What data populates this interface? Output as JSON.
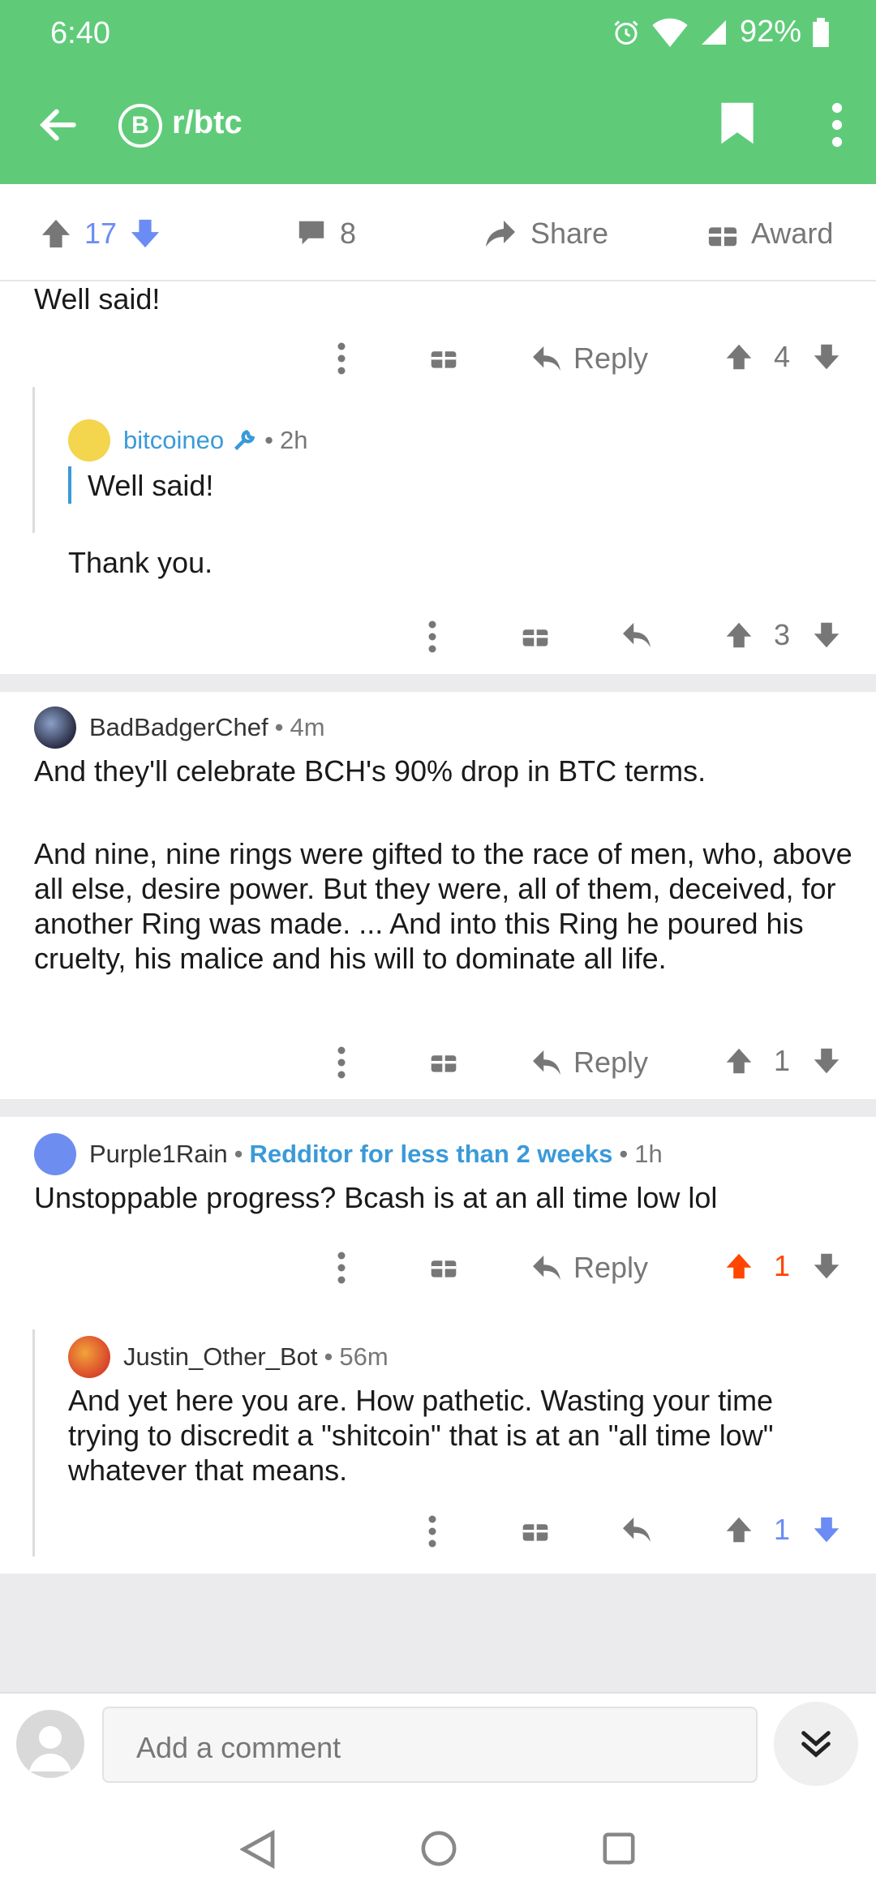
{
  "status": {
    "time": "6:40",
    "battery": "92%"
  },
  "header": {
    "subreddit": "r/btc",
    "subreddit_icon": "bitcoin-icon"
  },
  "post_actions": {
    "votes": "17",
    "comments": "8",
    "share": "Share",
    "award": "Award"
  },
  "comments": [
    {
      "text": "Well said!",
      "actions": {
        "reply": "Reply",
        "score": "4"
      }
    },
    {
      "author": "bitcoineo",
      "time": "2h",
      "quote": "Well said!",
      "text": "Thank you.",
      "actions": {
        "score": "3"
      }
    },
    {
      "author": "BadBadgerChef",
      "time": "4m",
      "text1": "And they'll celebrate BCH's 90% drop in BTC terms.",
      "text2": "And nine, nine rings were gifted to the race of men, who, above all else, desire power. But they were, all of them, deceived, for another Ring was made. ... And into this Ring he poured his cruelty, his malice and his will to dominate all life.",
      "actions": {
        "reply": "Reply",
        "score": "1"
      }
    },
    {
      "author": "Purple1Rain",
      "flair": "Redditor for less than 2 weeks",
      "time": "1h",
      "text": "Unstoppable progress? Bcash is at an all time low lol",
      "actions": {
        "reply": "Reply",
        "score": "1"
      }
    },
    {
      "author": "Justin_Other_Bot",
      "time": "56m",
      "text": "And yet here you are. How pathetic. Wasting your time trying to discredit a \"shitcoin\" that is at an \"all time low\" whatever that means.",
      "actions": {
        "score": "1"
      }
    }
  ],
  "composer": {
    "placeholder": "Add a comment"
  },
  "colors": {
    "header": "#5fcb79",
    "upvote": "#ff4500",
    "downvote": "#6b8cf4",
    "link": "#3a9ad9"
  }
}
